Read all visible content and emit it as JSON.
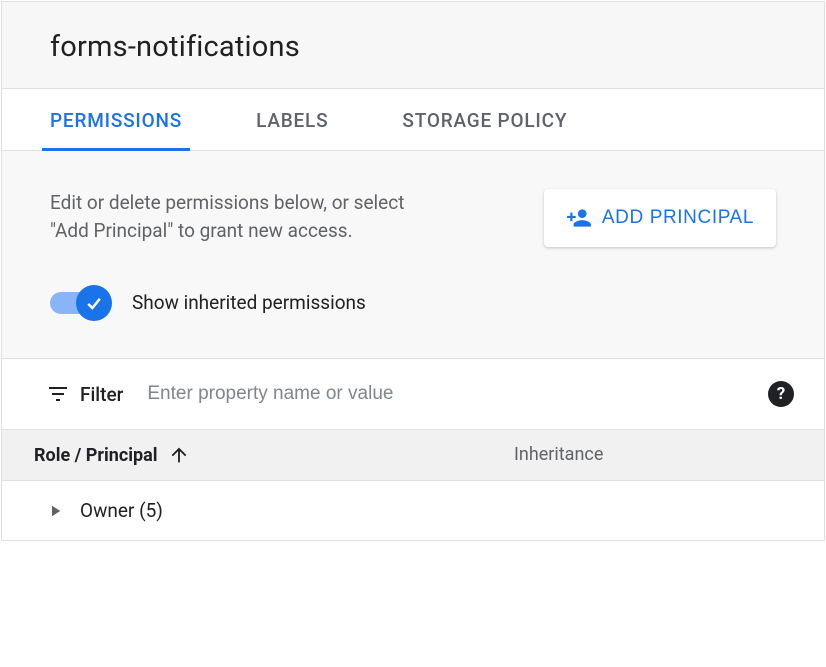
{
  "title": "forms-notifications",
  "tabs": [
    {
      "label": "Permissions",
      "active": true
    },
    {
      "label": "Labels",
      "active": false
    },
    {
      "label": "Storage Policy",
      "active": false
    }
  ],
  "description": "Edit or delete permissions below, or select \"Add Principal\" to grant new access.",
  "addButton": {
    "label": "Add Principal"
  },
  "toggle": {
    "label": "Show inherited permissions",
    "on": true
  },
  "filter": {
    "label": "Filter",
    "placeholder": "Enter property name or value"
  },
  "table": {
    "columns": {
      "role": "Role / Principal",
      "inheritance": "Inheritance"
    },
    "rows": [
      {
        "label": "Owner (5)"
      }
    ]
  }
}
